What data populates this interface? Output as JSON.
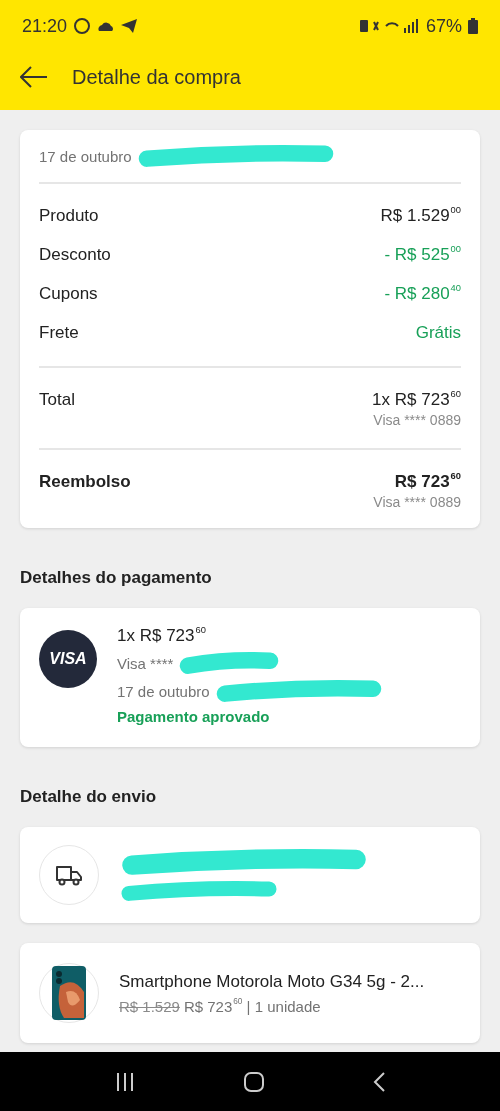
{
  "status_bar": {
    "time": "21:20",
    "battery": "67%"
  },
  "app_bar": {
    "title": "Detalhe da compra"
  },
  "summary": {
    "date": "17 de outubro",
    "lines": [
      {
        "label": "Produto",
        "value": "R$ 1.529$^{00}$",
        "color": "#222222"
      },
      {
        "label": "Desconto",
        "value": "- R$ 525$^{00}$",
        "color": "#18a058"
      },
      {
        "label": "Cupons",
        "value": "- R$ 280$^{40}$",
        "color": "#18a058"
      },
      {
        "label": "Frete",
        "value": "Grátis",
        "color": "#18a058"
      }
    ],
    "totals": [
      {
        "label": "Total",
        "value": "1x R$ 723$^{60}$",
        "card": "Visa **** 0889",
        "bold": false
      },
      {
        "label": "Reembolso",
        "value": "R$ 723$^{60}$",
        "card": "Visa **** 0889",
        "bold": true
      }
    ]
  },
  "payment": {
    "heading": "Detalhes do pagamento",
    "brand": "VISA",
    "amount": "1x R$ 723$^{60}$",
    "card": "Visa ****",
    "date": "17 de outubro",
    "status": "Pagamento aprovado"
  },
  "shipping": {
    "heading": "Detalhe do envio"
  },
  "product": {
    "name": "Smartphone Motorola Moto G34 5g - 2...",
    "old_price": "R$ 1.529",
    "price": "R$ 723$^{60}$ | 1 unidade"
  }
}
